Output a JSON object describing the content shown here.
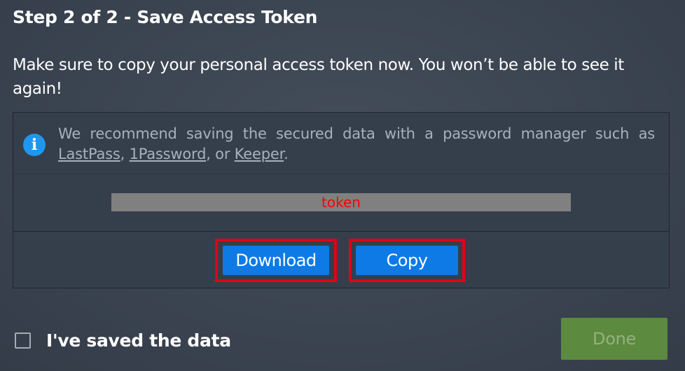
{
  "dialog": {
    "title": "Step 2 of 2 - Save Access Token",
    "message": "Make sure to copy your personal access token now. You won’t be able to see it again!"
  },
  "info": {
    "icon": "info-icon",
    "icon_glyph": "i",
    "text_before": "We recommend saving the secured data with a password manager such as ",
    "link_lastpass": "LastPass",
    "sep1": ", ",
    "link_1password": "1Password",
    "sep2": ", or ",
    "link_keeper": "Keeper",
    "text_after": "."
  },
  "token": {
    "value": "token"
  },
  "actions": {
    "download_label": "Download",
    "copy_label": "Copy"
  },
  "footer": {
    "checkbox_label": "I've saved the data",
    "done_label": "Done"
  },
  "colors": {
    "background": "#3b4451",
    "primary_button": "#0e7ae6",
    "done_button_disabled": "#5c8a3f",
    "highlight_border": "#e0001a",
    "info_icon": "#1f97ef",
    "token_text": "#ff0000"
  }
}
